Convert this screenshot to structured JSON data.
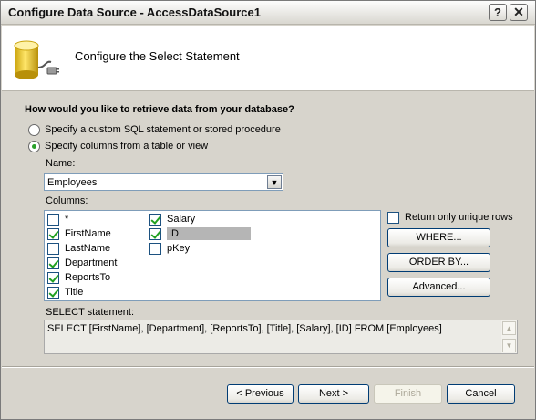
{
  "window": {
    "title": "Configure Data Source - AccessDataSource1",
    "help_label": "?",
    "close_label": "✕"
  },
  "header": {
    "title": "Configure the Select Statement",
    "icon": "database-plug-icon"
  },
  "question": "How would you like to retrieve data from your database?",
  "options": {
    "custom_sql": "Specify a custom SQL statement or stored procedure",
    "columns_from_table": "Specify columns from a table or view",
    "selected": "columns_from_table"
  },
  "name_field": {
    "label": "Name:",
    "value": "Employees"
  },
  "columns": {
    "label": "Columns:",
    "items": [
      {
        "label": "*",
        "checked": false
      },
      {
        "label": "FirstName",
        "checked": true
      },
      {
        "label": "LastName",
        "checked": false
      },
      {
        "label": "Department",
        "checked": true
      },
      {
        "label": "ReportsTo",
        "checked": true
      },
      {
        "label": "Title",
        "checked": true
      },
      {
        "label": "Salary",
        "checked": true
      },
      {
        "label": "ID",
        "checked": true
      },
      {
        "label": "pKey",
        "checked": false
      }
    ]
  },
  "side": {
    "unique_rows_label": "Return only unique rows",
    "unique_rows_checked": false,
    "where_label": "WHERE...",
    "order_by_label": "ORDER BY...",
    "advanced_label": "Advanced..."
  },
  "statement": {
    "label": "SELECT statement:",
    "text": "SELECT [FirstName], [Department], [ReportsTo], [Title], [Salary], [ID] FROM [Employees]"
  },
  "footer": {
    "previous_label": "< Previous",
    "next_label": "Next >",
    "finish_label": "Finish",
    "cancel_label": "Cancel"
  },
  "colors": {
    "dialog_bg": "#d7d4cc",
    "check_green": "#21a121",
    "selection_gray": "#b5b5b5"
  }
}
